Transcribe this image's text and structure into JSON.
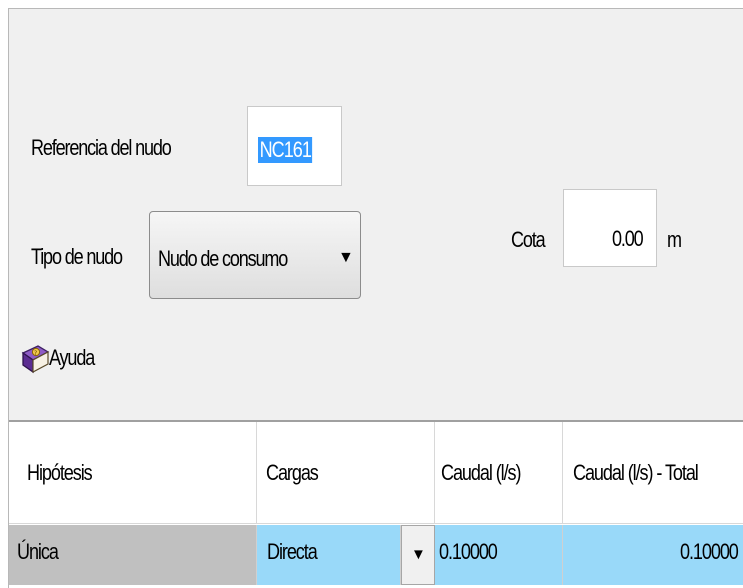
{
  "form": {
    "node_ref_label": "Referencia del nudo",
    "node_ref_value": "NC161",
    "node_type_label": "Tipo de nudo",
    "node_type_value": "Nudo de consumo",
    "elevation_label": "Cota",
    "elevation_value": "0.00",
    "elevation_unit": "m",
    "help_label": "Ayuda"
  },
  "table": {
    "columns": [
      "Hipótesis",
      "Cargas",
      "Caudal (l/s)",
      "Caudal (l/s) - Total"
    ],
    "rows": [
      {
        "hypothesis": "Única",
        "load": "Directa",
        "flow": "0.10000",
        "flow_total": "0.10000"
      }
    ]
  },
  "colors": {
    "panel_bg": "#f0f0f0",
    "selection": "#3399ff",
    "row_first_cell": "#c0c0c0",
    "row_highlight": "#99d9f9"
  },
  "icons": {
    "help": "help-book-icon",
    "dropdown": "triangle-down-icon"
  }
}
